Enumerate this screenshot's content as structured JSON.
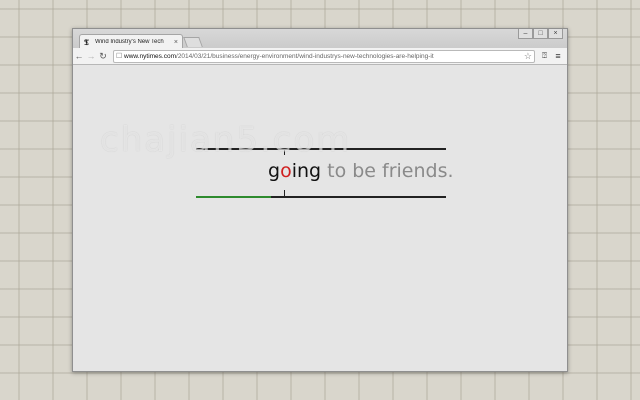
{
  "browser": {
    "tab": {
      "favicon": "𝕿",
      "title": "Wind Industry's New Tech",
      "close": "×"
    },
    "window_controls": {
      "minimize": "–",
      "maximize": "□",
      "close": "×"
    },
    "toolbar": {
      "back": "←",
      "forward": "→",
      "reload": "↻",
      "page_icon": "☐",
      "url_host": "www.nytimes.com",
      "url_path": "/2014/03/21/business/energy-environment/wind-industrys-new-technologies-are-helping-it",
      "star": "☆",
      "extension": "⍰",
      "menu": "≡"
    }
  },
  "reader": {
    "word_pre": "g",
    "word_orp": "o",
    "word_post": "ing",
    "rest": " to be friends.",
    "progress_fraction": 0.3,
    "accent_color": "#d02020",
    "progress_color": "#2e8b2e"
  },
  "watermark": "chajian5.com"
}
